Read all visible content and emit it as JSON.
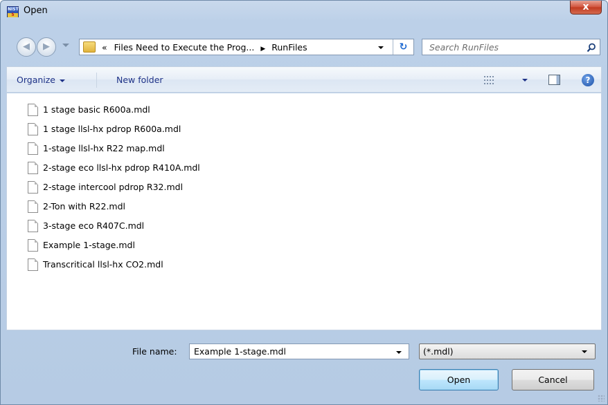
{
  "window": {
    "title": "Open",
    "app_icon": {
      "top": "NIST",
      "bottom": "5"
    },
    "close_label": "x"
  },
  "nav": {
    "back_glyph": "◀",
    "forward_glyph": "▶",
    "breadcrumb": {
      "overflow": "«",
      "segments": [
        "Files Need to Execute the Prog...",
        "RunFiles"
      ],
      "separator": "▶"
    },
    "refresh_glyph": "↻",
    "search_placeholder": "Search RunFiles"
  },
  "toolbar": {
    "organize_label": "Organize",
    "new_folder_label": "New folder",
    "help_glyph": "?"
  },
  "files": [
    "1 stage basic R600a.mdl",
    "1 stage llsl-hx pdrop R600a.mdl",
    "1-stage llsl-hx R22 map.mdl",
    "2-stage eco llsl-hx pdrop R410A.mdl",
    "2-stage intercool pdrop R32.mdl",
    "2-Ton with R22.mdl",
    "3-stage eco R407C.mdl",
    "Example 1-stage.mdl",
    "Transcritical llsl-hx CO2.mdl"
  ],
  "bottom": {
    "file_name_label": "File name:",
    "file_name_value": "Example 1-stage.mdl",
    "filter_value": "(*.mdl)",
    "open_label": "Open",
    "cancel_label": "Cancel"
  },
  "colors": {
    "chrome": "#bcd0e8",
    "link_text": "#1e3287",
    "close": "#c13a20"
  }
}
